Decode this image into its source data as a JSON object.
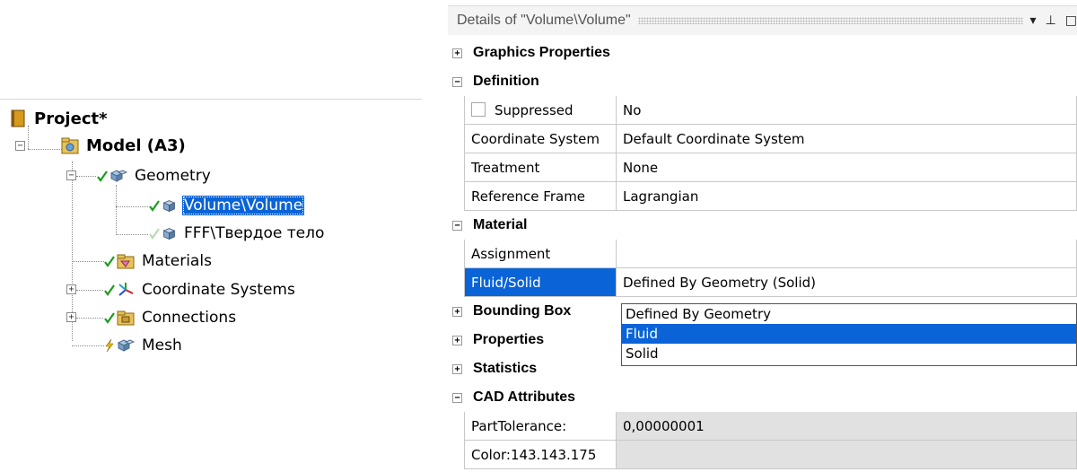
{
  "tree": {
    "project": "Project*",
    "model": "Model (A3)",
    "geometry": "Geometry",
    "volume": "Volume\\Volume",
    "solid_body": "FFF\\Твердое тело",
    "materials": "Materials",
    "coordinate_systems": "Coordinate Systems",
    "connections": "Connections",
    "mesh": "Mesh"
  },
  "details": {
    "title": "Details of \"Volume\\Volume\"",
    "pin_glyph": "▾ ⊥ □",
    "sections": {
      "graphics": "Graphics Properties",
      "definition": "Definition",
      "material": "Material",
      "bounding_box": "Bounding Box",
      "properties": "Properties",
      "statistics": "Statistics",
      "cad": "CAD Attributes"
    },
    "rows": {
      "suppressed": {
        "name": "Suppressed",
        "value": "No"
      },
      "coord_system": {
        "name": "Coordinate System",
        "value": "Default Coordinate System"
      },
      "treatment": {
        "name": "Treatment",
        "value": "None"
      },
      "ref_frame": {
        "name": "Reference Frame",
        "value": "Lagrangian"
      },
      "assignment": {
        "name": "Assignment",
        "value": ""
      },
      "fluid_solid": {
        "name": "Fluid/Solid",
        "value": "Defined By Geometry (Solid)"
      },
      "part_tolerance": {
        "name": "PartTolerance:",
        "value": "0,00000001"
      },
      "color": {
        "name": "Color:143.143.175",
        "value": ""
      }
    },
    "dropdown_options": [
      "Defined By Geometry",
      "Fluid",
      "Solid"
    ],
    "dropdown_highlighted": "Fluid"
  },
  "colors": {
    "selection": "#0a64d8",
    "check": "#1f9b1f",
    "lightning": "#e8b800"
  }
}
